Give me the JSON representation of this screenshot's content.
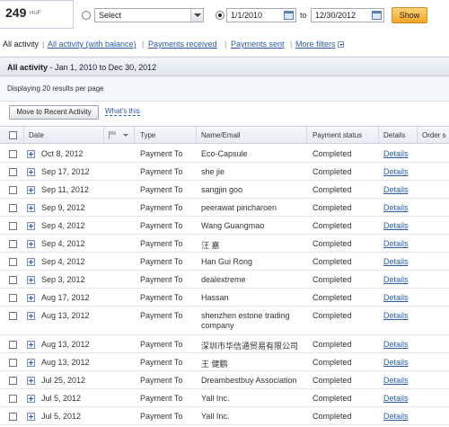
{
  "balance": {
    "amount": "249",
    "currency": "HUF"
  },
  "filter_bar": {
    "select_value": "Select",
    "date_from": "1/1/2010",
    "to_label": "to",
    "date_to": "12/30/2012",
    "show_label": "Show"
  },
  "tabs": [
    {
      "label": "All activity"
    },
    {
      "label": "All activity (with balance)"
    },
    {
      "label": "Payments received"
    },
    {
      "label": "Payments sent"
    },
    {
      "label": "More filters"
    }
  ],
  "panel": {
    "title": "All activity",
    "range": "- Jan 1, 2010 to Dec 30, 2012",
    "display": "Displaying 20 results per page",
    "move_label": "Move to Recent Activity",
    "whats_this": "What's this"
  },
  "columns": {
    "date": "Date",
    "type": "Type",
    "name": "Name/Email",
    "status": "Payment status",
    "details": "Details",
    "order": "Order s"
  },
  "rows": [
    {
      "date": "Oct 8, 2012",
      "type": "Payment To",
      "name": "Eco-Capsule",
      "status": "Completed",
      "details": "Details"
    },
    {
      "date": "Sep 17, 2012",
      "type": "Payment To",
      "name": "she jie",
      "status": "Completed",
      "details": "Details"
    },
    {
      "date": "Sep 11, 2012",
      "type": "Payment To",
      "name": "sangjin goo",
      "status": "Completed",
      "details": "Details"
    },
    {
      "date": "Sep 9, 2012",
      "type": "Payment To",
      "name": "peerawat pincharoen",
      "status": "Completed",
      "details": "Details"
    },
    {
      "date": "Sep 4, 2012",
      "type": "Payment To",
      "name": "Wang Guangmao",
      "status": "Completed",
      "details": "Details"
    },
    {
      "date": "Sep 4, 2012",
      "type": "Payment To",
      "name": "汪 嘉",
      "status": "Completed",
      "details": "Details"
    },
    {
      "date": "Sep 4, 2012",
      "type": "Payment To",
      "name": "Han Gui Rong",
      "status": "Completed",
      "details": "Details"
    },
    {
      "date": "Sep 3, 2012",
      "type": "Payment To",
      "name": "dealextreme",
      "status": "Completed",
      "details": "Details"
    },
    {
      "date": "Aug 17, 2012",
      "type": "Payment To",
      "name": "Hassan",
      "status": "Completed",
      "details": "Details"
    },
    {
      "date": "Aug 13, 2012",
      "type": "Payment To",
      "name": "shenzhen estone trading company",
      "status": "Completed",
      "details": "Details"
    },
    {
      "date": "Aug 13, 2012",
      "type": "Payment To",
      "name": "深圳市华信通贸易有限公司",
      "status": "Completed",
      "details": "Details"
    },
    {
      "date": "Aug 13, 2012",
      "type": "Payment To",
      "name": "王 健鹏",
      "status": "Completed",
      "details": "Details"
    },
    {
      "date": "Jul 25, 2012",
      "type": "Payment To",
      "name": "Dreambestbuy Association",
      "status": "Completed",
      "details": "Details"
    },
    {
      "date": "Jul 5, 2012",
      "type": "Payment To",
      "name": "Yall Inc.",
      "status": "Completed",
      "details": "Details"
    },
    {
      "date": "Jul 5, 2012",
      "type": "Payment To",
      "name": "Yall Inc.",
      "status": "Completed",
      "details": "Details"
    }
  ]
}
